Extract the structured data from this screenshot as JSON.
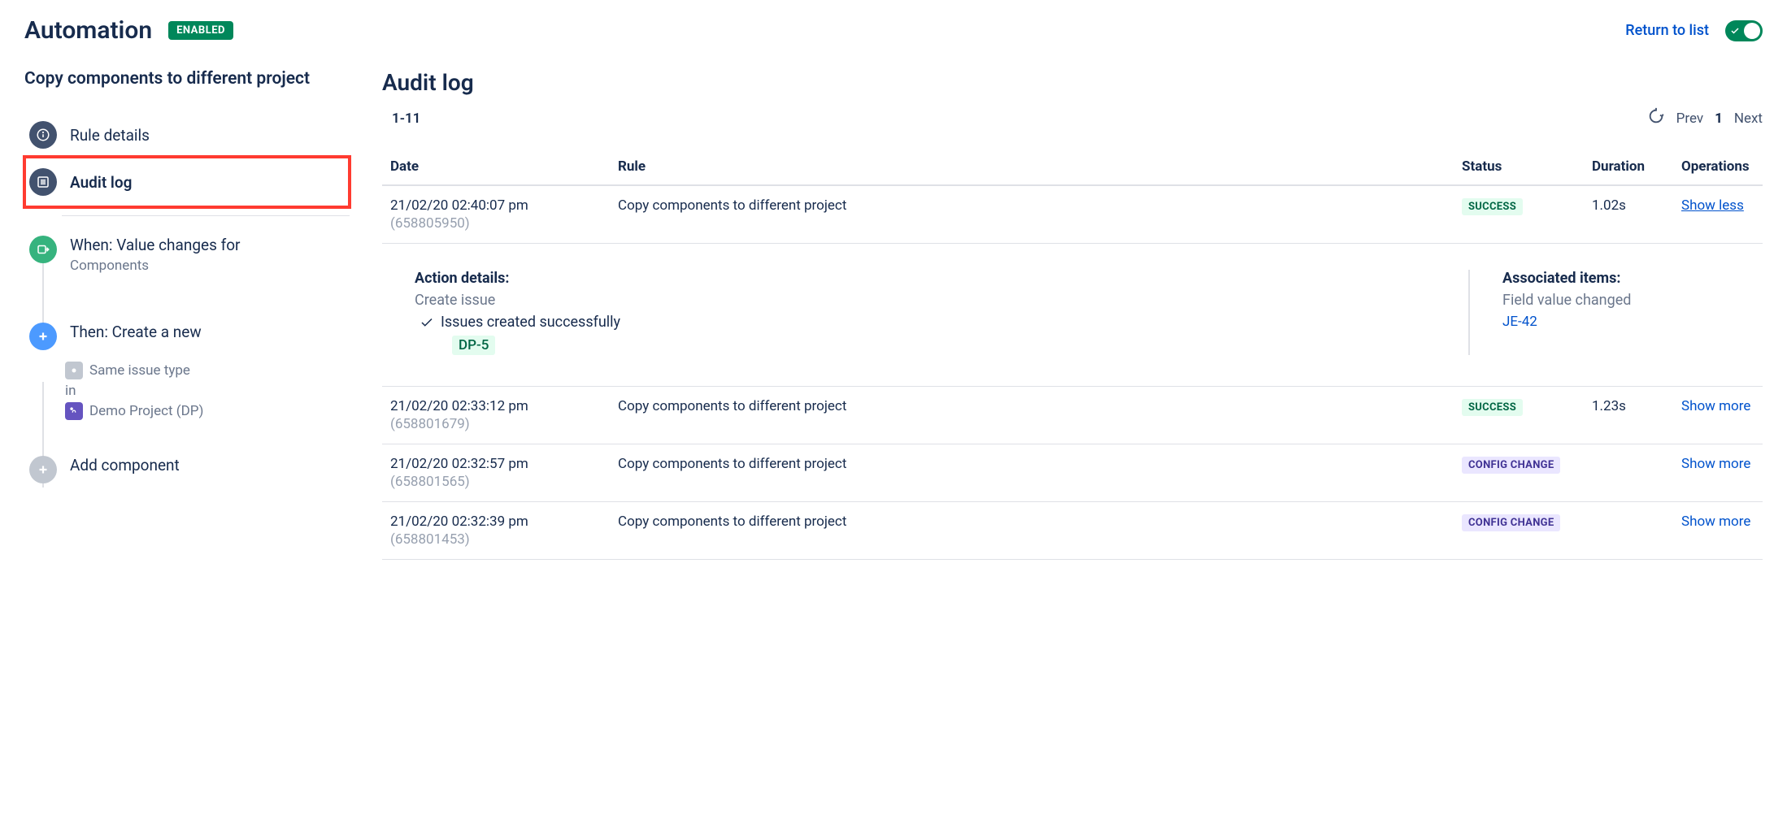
{
  "header": {
    "title": "Automation",
    "enabled_badge": "ENABLED",
    "return_link": "Return to list"
  },
  "sidebar": {
    "rule_name": "Copy components to different project",
    "items": [
      {
        "label": "Rule details"
      },
      {
        "label": "Audit log"
      }
    ],
    "trigger": {
      "label": "When: Value changes for",
      "sub": "Components"
    },
    "action": {
      "label": "Then: Create a new",
      "line1": "Same issue type",
      "line2_prefix": "in",
      "line2_project": "Demo Project (DP)"
    },
    "add_component": "Add component"
  },
  "main": {
    "title": "Audit log",
    "range": "1-11",
    "pager": {
      "prev": "Prev",
      "page": "1",
      "next": "Next"
    },
    "columns": {
      "date": "Date",
      "rule": "Rule",
      "status": "Status",
      "duration": "Duration",
      "operations": "Operations"
    },
    "rows": [
      {
        "date": "21/02/20 02:40:07 pm",
        "id": "(658805950)",
        "rule": "Copy components to different project",
        "status_type": "success",
        "status": "SUCCESS",
        "duration": "1.02s",
        "op": "Show less",
        "expanded": true
      },
      {
        "date": "21/02/20 02:33:12 pm",
        "id": "(658801679)",
        "rule": "Copy components to different project",
        "status_type": "success",
        "status": "SUCCESS",
        "duration": "1.23s",
        "op": "Show more",
        "expanded": false
      },
      {
        "date": "21/02/20 02:32:57 pm",
        "id": "(658801565)",
        "rule": "Copy components to different project",
        "status_type": "config",
        "status": "CONFIG CHANGE",
        "duration": "",
        "op": "Show more",
        "expanded": false
      },
      {
        "date": "21/02/20 02:32:39 pm",
        "id": "(658801453)",
        "rule": "Copy components to different project",
        "status_type": "config",
        "status": "CONFIG CHANGE",
        "duration": "",
        "op": "Show more",
        "expanded": false
      }
    ],
    "expanded_detail": {
      "action_title": "Action details:",
      "action_sub": "Create issue",
      "success_msg": "Issues created successfully",
      "issue_key": "DP-5",
      "assoc_title": "Associated items:",
      "assoc_sub": "Field value changed",
      "assoc_link": "JE-42"
    }
  }
}
